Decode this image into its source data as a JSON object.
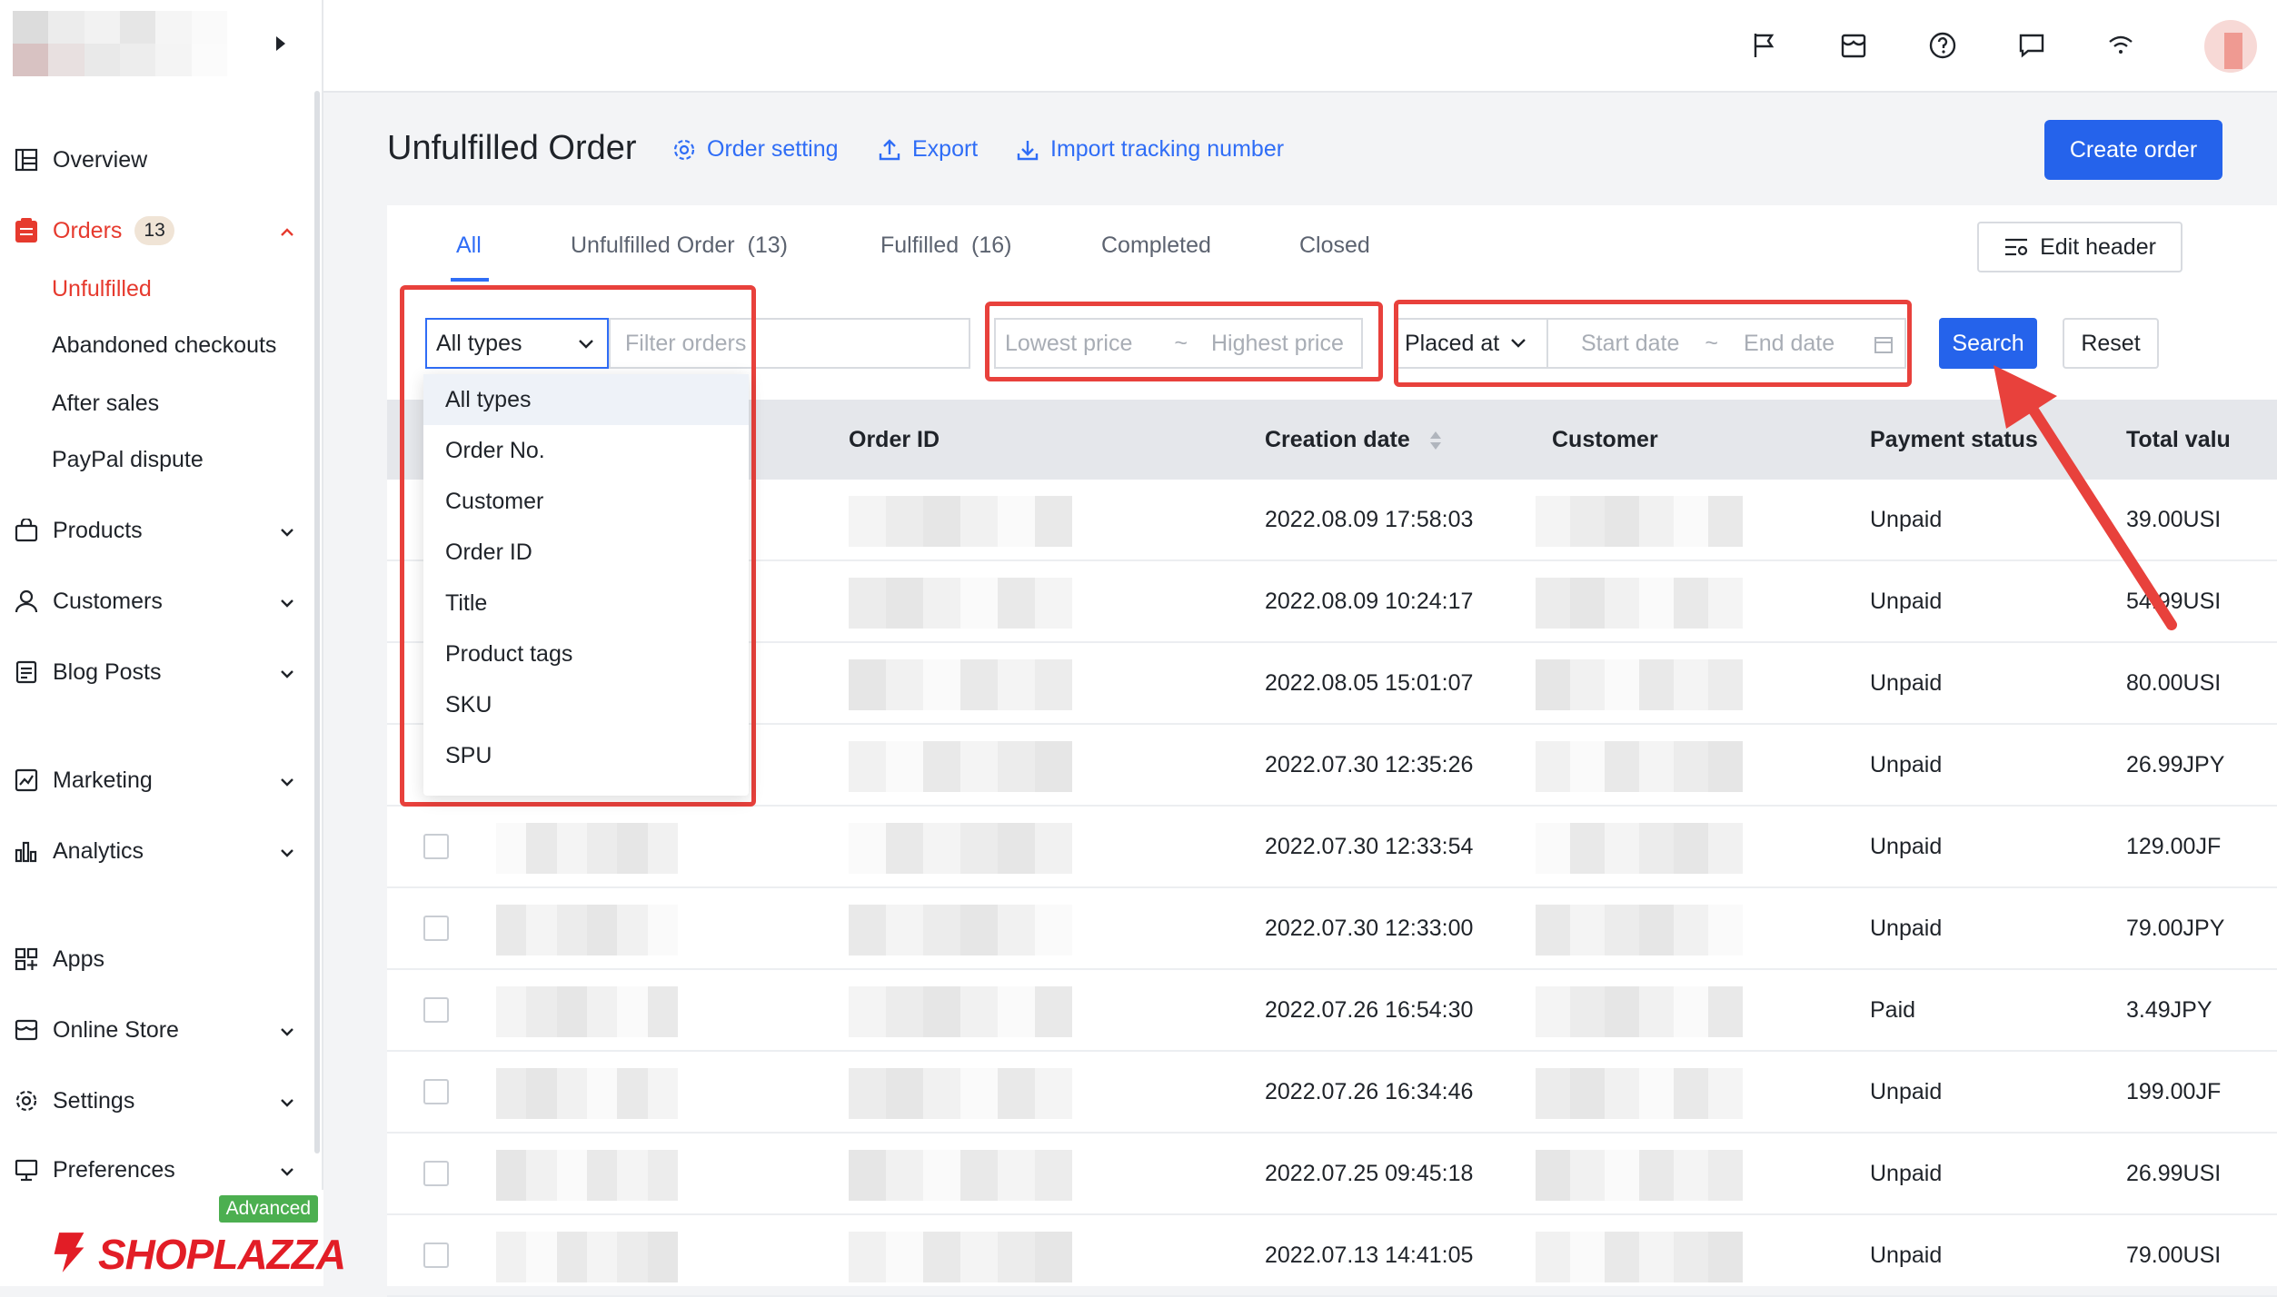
{
  "sidebar": {
    "items": [
      {
        "key": "overview",
        "label": "Overview",
        "icon": "dashboard-icon"
      },
      {
        "key": "orders",
        "label": "Orders",
        "icon": "orders-icon",
        "badge": "13"
      },
      {
        "key": "unfulfilled",
        "label": "Unfulfilled"
      },
      {
        "key": "abandoned",
        "label": "Abandoned checkouts"
      },
      {
        "key": "after_sales",
        "label": "After sales"
      },
      {
        "key": "paypal",
        "label": "PayPal dispute"
      },
      {
        "key": "products",
        "label": "Products",
        "icon": "shopping-bag-icon"
      },
      {
        "key": "customers",
        "label": "Customers",
        "icon": "user-icon"
      },
      {
        "key": "blog",
        "label": "Blog Posts",
        "icon": "document-icon"
      },
      {
        "key": "marketing",
        "label": "Marketing",
        "icon": "marketing-icon"
      },
      {
        "key": "analytics",
        "label": "Analytics",
        "icon": "bar-chart-icon"
      },
      {
        "key": "apps",
        "label": "Apps",
        "icon": "apps-grid-icon"
      },
      {
        "key": "online_store",
        "label": "Online Store",
        "icon": "storefront-icon"
      },
      {
        "key": "settings",
        "label": "Settings",
        "icon": "gear-icon"
      },
      {
        "key": "preferences",
        "label": "Preferences",
        "icon": "monitor-icon"
      }
    ],
    "plan_badge": "Advanced",
    "brand": "SHOPLAZZA"
  },
  "topbar": {
    "icons": [
      "flag-icon",
      "store-icon",
      "help-icon",
      "message-icon",
      "wifi-icon"
    ]
  },
  "header": {
    "title": "Unfulfilled Order",
    "order_setting": "Order setting",
    "export": "Export",
    "import_tracking": "Import tracking number",
    "create_order": "Create order"
  },
  "tabs": [
    {
      "label": "All",
      "active": true
    },
    {
      "label": "Unfulfilled Order  (13)"
    },
    {
      "label": "Fulfilled  (16)"
    },
    {
      "label": "Completed"
    },
    {
      "label": "Closed"
    }
  ],
  "edit_header": "Edit header",
  "filters": {
    "type_select": "All types",
    "filter_placeholder": "Filter orders",
    "lowest_price": "Lowest price",
    "price_sep": "~",
    "highest_price": "Highest price",
    "date_type": "Placed at",
    "start_date": "Start date",
    "date_sep": "~",
    "end_date": "End date",
    "search": "Search",
    "reset": "Reset"
  },
  "dropdown_options": [
    "All types",
    "Order No.",
    "Customer",
    "Order ID",
    "Title",
    "Product tags",
    "SKU",
    "SPU"
  ],
  "table": {
    "columns": [
      "Order ID",
      "Creation date",
      "Customer",
      "Payment status",
      "Total valu"
    ],
    "rows": [
      {
        "date": "2022.08.09 17:58:03",
        "payment": "Unpaid",
        "total": "39.00USI"
      },
      {
        "date": "2022.08.09 10:24:17",
        "payment": "Unpaid",
        "total": "54.99USI"
      },
      {
        "date": "2022.08.05 15:01:07",
        "payment": "Unpaid",
        "total": "80.00USI"
      },
      {
        "date": "2022.07.30 12:35:26",
        "payment": "Unpaid",
        "total": "26.99JPY"
      },
      {
        "date": "2022.07.30 12:33:54",
        "payment": "Unpaid",
        "total": "129.00JF"
      },
      {
        "date": "2022.07.30 12:33:00",
        "payment": "Unpaid",
        "total": "79.00JPY"
      },
      {
        "date": "2022.07.26 16:54:30",
        "payment": "Paid",
        "total": "3.49JPY"
      },
      {
        "date": "2022.07.26 16:34:46",
        "payment": "Unpaid",
        "total": "199.00JF"
      },
      {
        "date": "2022.07.25 09:45:18",
        "payment": "Unpaid",
        "total": "26.99USI"
      },
      {
        "date": "2022.07.13 14:41:05",
        "payment": "Unpaid",
        "total": "79.00USI"
      }
    ]
  },
  "colors": {
    "accent": "#2563eb",
    "active_nav": "#e63a2e",
    "highlight": "#e8413c",
    "brand": "#e21d26"
  }
}
